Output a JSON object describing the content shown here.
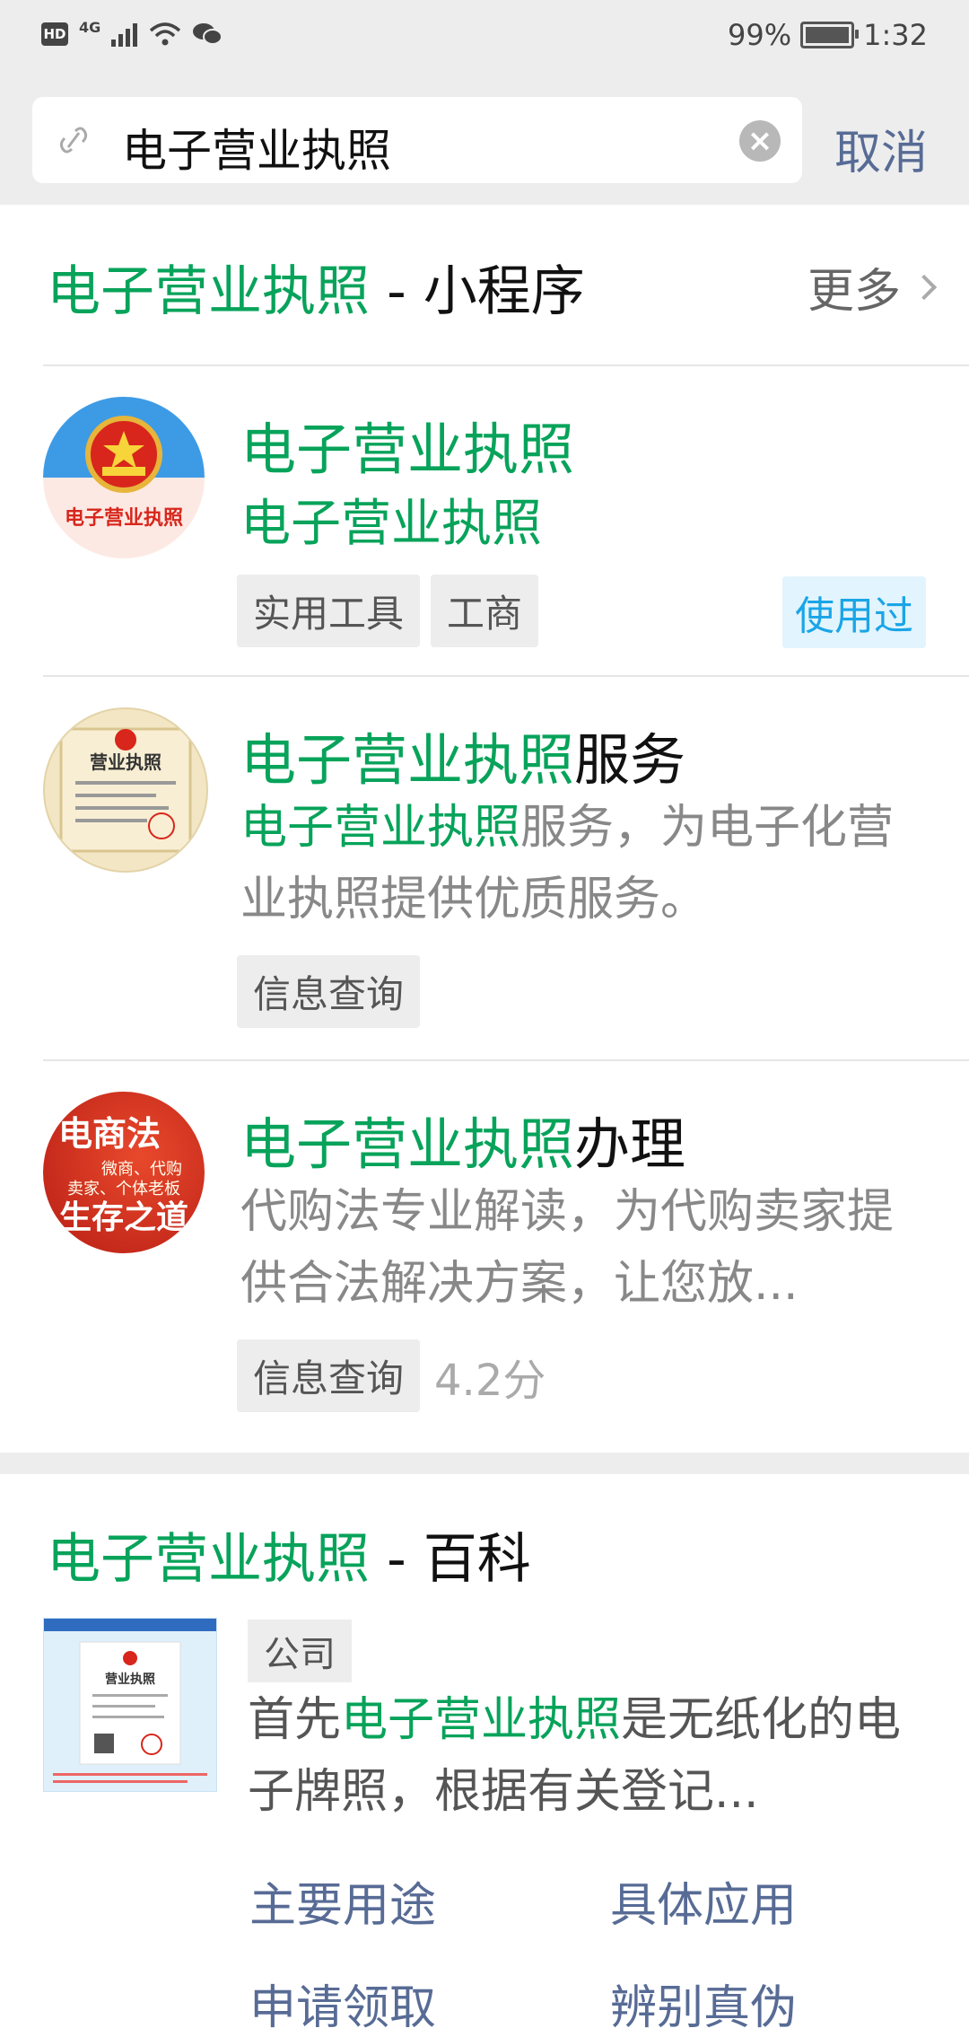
{
  "status_bar": {
    "left_badge": "HD",
    "network": "4G",
    "battery": "99%",
    "time": "1:32"
  },
  "search": {
    "query": "电子营业执照",
    "cancel_label": "取消"
  },
  "mini_programs": {
    "title_keyword": "电子营业执照",
    "title_suffix": " - 小程序",
    "more_label": "更多",
    "items": [
      {
        "title_keyword": "电子营业执照",
        "title_rest": "",
        "desc_keyword": "电子营业执照",
        "desc_rest": "",
        "tags": [
          "实用工具",
          "工商"
        ],
        "used_label": "使用过",
        "avatar_text": "电子营业执照"
      },
      {
        "title_keyword": "电子营业执照",
        "title_rest": "服务",
        "desc_keyword": "电子营业执照",
        "desc_rest": "服务，为电子化营业执照提供优质服务。",
        "tags": [
          "信息查询"
        ],
        "avatar_text": "营业执照"
      },
      {
        "title_keyword": "电子营业执照",
        "title_rest": "办理",
        "desc_rest": "代购法专业解读，为代购卖家提供合法解决方案，让您放...",
        "tags": [
          "信息查询"
        ],
        "rating": "4.2分",
        "avatar_lines": [
          "电商法",
          "微商、代购",
          "卖家、个体老板",
          "生存之道"
        ]
      }
    ]
  },
  "baike": {
    "title_keyword": "电子营业执照",
    "title_suffix": " - 百科",
    "tag": "公司",
    "desc_prefix": "首先",
    "desc_keyword": "电子营业执照",
    "desc_rest": "是无纸化的电子牌照，根据有关登记...",
    "links": [
      "主要用途",
      "具体应用",
      "申请领取",
      "辨别真伪"
    ],
    "thumb_text": "营业执照"
  },
  "colors": {
    "highlight": "#07a35a",
    "link": "#576b95",
    "used_badge": "#1aa5e6"
  }
}
